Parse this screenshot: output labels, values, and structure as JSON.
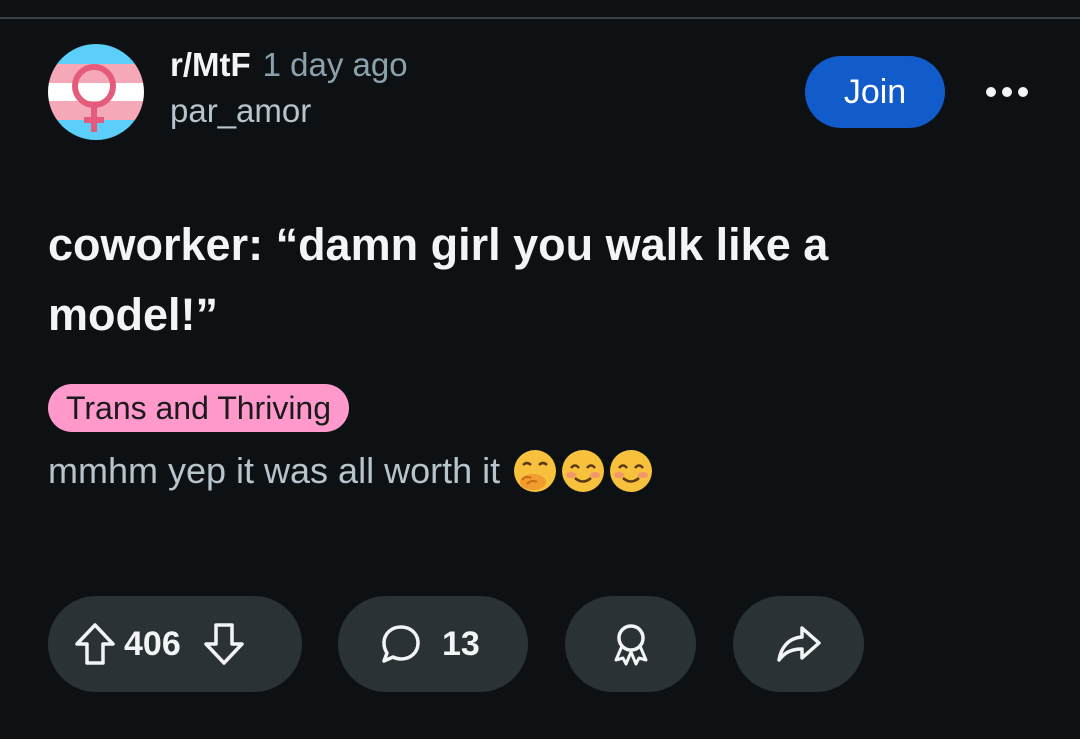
{
  "post": {
    "subreddit": "r/MtF",
    "timestamp": "1 day ago",
    "author": "par_amor",
    "title": "coworker: “damn girl you walk like a model!”",
    "flair": {
      "label": "Trans and Thriving",
      "background": "#ff99cc"
    },
    "body": "mmhm yep it was all worth it",
    "body_emojis": [
      "face-with-hand-over-mouth",
      "smiling-face-with-smiling-eyes",
      "smiling-face-with-smiling-eyes"
    ]
  },
  "header": {
    "join_label": "Join",
    "more_icon": "more-horizontal-icon",
    "avatar_icon": "trans-symbol-icon"
  },
  "actions": {
    "vote_count": "406",
    "comment_count": "13",
    "upvote_icon": "upvote-arrow-icon",
    "downvote_icon": "downvote-arrow-icon",
    "comment_icon": "comment-bubble-icon",
    "award_icon": "award-icon",
    "share_icon": "share-arrow-icon"
  },
  "colors": {
    "background": "#0e1113",
    "join_button": "#115bca",
    "pill_background": "#2a3236",
    "trans_blue": "#5bcefa",
    "trans_pink": "#f5a9b8",
    "trans_white": "#ffffff",
    "symbol": "#e55b7b"
  }
}
